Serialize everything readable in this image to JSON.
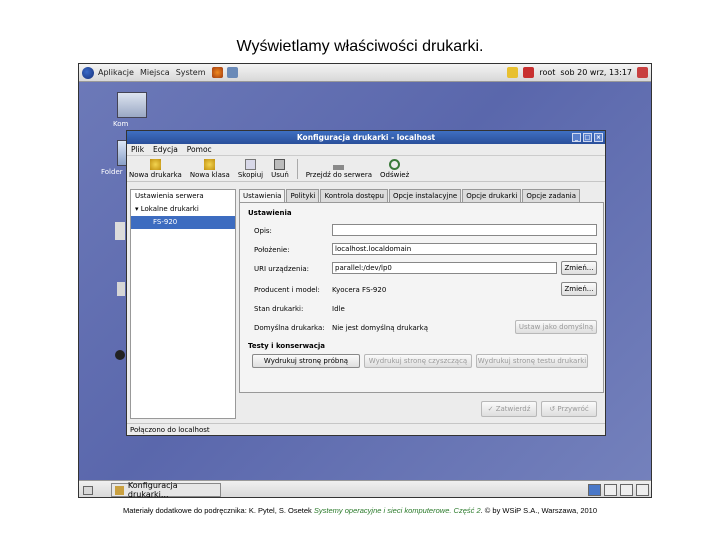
{
  "slide": {
    "title": "Wyświetlamy właściwości drukarki.",
    "footer_prefix": "Materiały dodatkowe do podręcznika: K. Pytel, S. Osetek ",
    "footer_book": "Systemy operacyjne i sieci komputerowe. Część 2",
    "footer_suffix": ". © by WSiP S.A., Warszawa, 2010"
  },
  "top_panel": {
    "menus": [
      "Aplikacje",
      "Miejsca",
      "System"
    ],
    "user": "root",
    "clock": "sob 20 wrz, 13:17"
  },
  "desktop": {
    "icon_labels": [
      "Kom",
      "Folder"
    ]
  },
  "window": {
    "title": "Konfiguracja drukarki - localhost",
    "menu": [
      "Plik",
      "Edycja",
      "Pomoc"
    ],
    "toolbar": [
      "Nowa drukarka",
      "Nowa klasa",
      "Skopiuj",
      "Usuń",
      "Przejdź do serwera",
      "Odśwież"
    ],
    "tree": {
      "server_settings": "Ustawienia serwera",
      "local_printers": "Lokalne drukarki",
      "printer": "FS-920"
    },
    "tabs": [
      "Ustawienia",
      "Polityki",
      "Kontrola dostępu",
      "Opcje instalacyjne",
      "Opcje drukarki",
      "Opcje zadania"
    ],
    "settings": {
      "header": "Ustawienia",
      "opis_label": "Opis:",
      "opis_value": "",
      "polozenie_label": "Położenie:",
      "polozenie_value": "localhost.localdomain",
      "uri_label": "URI urządzenia:",
      "uri_value": "parallel:/dev/lp0",
      "change_label": "Zmień...",
      "maker_label": "Producent i model:",
      "maker_value": "Kyocera FS-920",
      "state_label": "Stan drukarki:",
      "state_value": "Idle",
      "default_label": "Domyślna drukarka:",
      "default_value": "Nie jest domyślną drukarką",
      "set_default_button": "Ustaw jako domyślną"
    },
    "maintenance": {
      "header": "Testy i konserwacja",
      "test_page": "Wydrukuj stronę próbną",
      "clean_page": "Wydrukuj stronę czyszczącą",
      "self_test": "Wydrukuj stronę testu drukarki"
    },
    "apply_button": "Zatwierdź",
    "revert_button": "Przywróć",
    "status": "Połączono do localhost"
  },
  "taskbar": {
    "task": "Konfiguracja drukarki..."
  },
  "colors": {
    "desktop": "#5a67ac",
    "titlebar": "#2a4f9a",
    "selection": "#3d6cc0"
  }
}
